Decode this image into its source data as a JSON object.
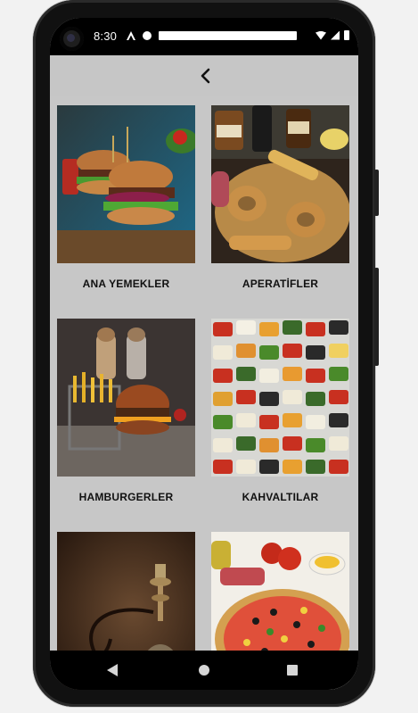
{
  "status_bar": {
    "time": "8:30",
    "left_icons": [
      "a-icon",
      "f-icon",
      "sd-card-icon"
    ],
    "right_icons": [
      "wifi-icon",
      "signal-icon",
      "battery-icon"
    ]
  },
  "toolbar": {
    "back_icon": "chevron-left-icon"
  },
  "categories": [
    {
      "label": "ANA YEMEKLER",
      "image": "burger-photo"
    },
    {
      "label": "APERATİFLER",
      "image": "appetizer-platter-photo"
    },
    {
      "label": "HAMBURGERLER",
      "image": "hamburger-fries-photo"
    },
    {
      "label": "KAHVALTILAR",
      "image": "breakfast-spread-photo"
    },
    {
      "label": "",
      "image": "hookah-photo"
    },
    {
      "label": "",
      "image": "pizza-photo"
    }
  ],
  "nav_bar": {
    "icons": [
      "nav-back-icon",
      "nav-home-icon",
      "nav-recents-icon"
    ]
  },
  "colors": {
    "screen_background": "#c7c7c7",
    "status_bar": "#000000",
    "label_text": "#111111"
  }
}
